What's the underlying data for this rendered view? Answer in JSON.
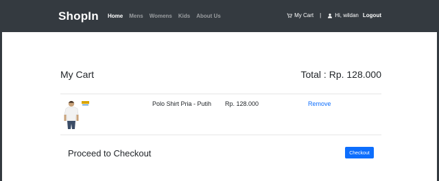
{
  "navbar": {
    "brand": "ShopIn",
    "links": [
      {
        "label": "Home",
        "active": true
      },
      {
        "label": "Mens",
        "active": false
      },
      {
        "label": "Womens",
        "active": false
      },
      {
        "label": "Kids",
        "active": false
      },
      {
        "label": "About Us",
        "active": false
      }
    ],
    "cart_label": "My Cart",
    "separator": "|",
    "user_greeting": "Hi, wildan",
    "logout_label": "Logout"
  },
  "cart": {
    "title": "My Cart",
    "total_text": "Total : Rp. 128.000",
    "items": [
      {
        "name": "Polo Shirt Pria - Putih",
        "price": "Rp. 128.000",
        "remove_label": "Remove",
        "image_icon": "product-image"
      }
    ]
  },
  "checkout": {
    "title": "Proceed to Checkout",
    "button_label": "Checkout"
  },
  "colors": {
    "navbar_bg": "#343a40",
    "accent": "#0d6efd"
  }
}
